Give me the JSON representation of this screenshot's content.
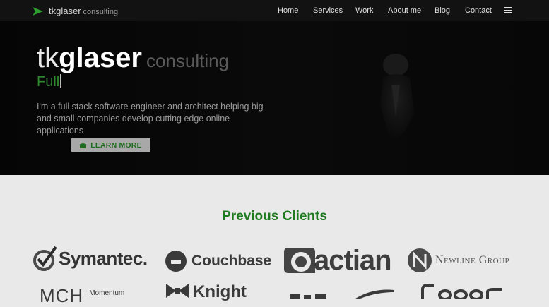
{
  "nav": {
    "brand_main": "tkglaser",
    "brand_sub": "consulting",
    "items": [
      {
        "label": "Home"
      },
      {
        "label": "Services"
      },
      {
        "label": "Work"
      },
      {
        "label": "About me"
      },
      {
        "label": "Blog"
      },
      {
        "label": "Contact"
      }
    ]
  },
  "hero": {
    "title_light": "tk",
    "title_bold": "glaser",
    "title_sub": "consulting",
    "typed_text": "Full",
    "tagline": "I'm a full stack software engineer and architect helping big and small companies develop cutting edge online applications",
    "button_label": "LEARN MORE"
  },
  "clients": {
    "heading": "Previous Clients",
    "logos": [
      {
        "name": "Symantec."
      },
      {
        "name": "Couchbase"
      },
      {
        "name": "actian"
      },
      {
        "name": "Newline Group"
      },
      {
        "name": "MCH",
        "extra": "Momentum"
      },
      {
        "name": "Knight"
      }
    ]
  },
  "colors": {
    "accent_green": "#1f7a1f",
    "typed_green": "#2e8b2e",
    "nav_bg": "#121212",
    "hero_bg": "#050505",
    "section_bg": "#e9e9e9"
  }
}
